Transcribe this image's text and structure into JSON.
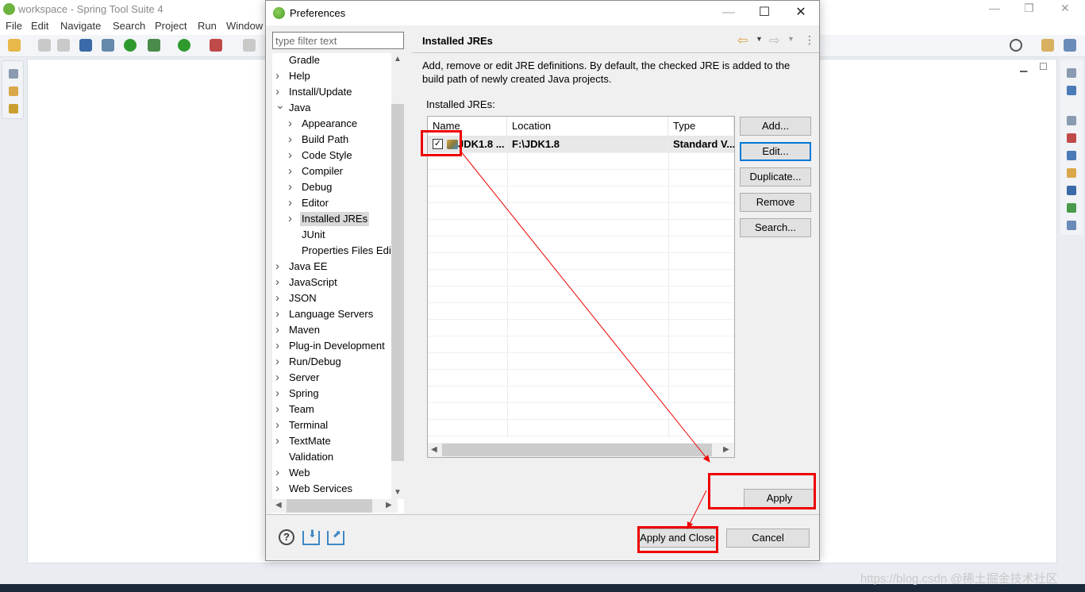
{
  "ide": {
    "title": "workspace - Spring Tool Suite 4",
    "menu": [
      "File",
      "Edit",
      "Navigate",
      "Search",
      "Project",
      "Run",
      "Window"
    ],
    "menu_mnemonics": [
      "F",
      "E",
      "N",
      "S",
      "P",
      "R",
      "W"
    ],
    "watermark": "https://blog.csdn @稀土掘金技术社区"
  },
  "dialog": {
    "title": "Preferences",
    "filter_placeholder": "type filter text",
    "tree": [
      {
        "label": "Gradle",
        "level": 0,
        "chevron": ""
      },
      {
        "label": "Help",
        "level": 0,
        "chevron": ">"
      },
      {
        "label": "Install/Update",
        "level": 0,
        "chevron": ">"
      },
      {
        "label": "Java",
        "level": 0,
        "chevron": "v"
      },
      {
        "label": "Appearance",
        "level": 1,
        "chevron": ">"
      },
      {
        "label": "Build Path",
        "level": 1,
        "chevron": ">"
      },
      {
        "label": "Code Style",
        "level": 1,
        "chevron": ">"
      },
      {
        "label": "Compiler",
        "level": 1,
        "chevron": ">"
      },
      {
        "label": "Debug",
        "level": 1,
        "chevron": ">"
      },
      {
        "label": "Editor",
        "level": 1,
        "chevron": ">"
      },
      {
        "label": "Installed JREs",
        "level": 1,
        "chevron": ">",
        "selected": true
      },
      {
        "label": "JUnit",
        "level": 1,
        "chevron": ""
      },
      {
        "label": "Properties Files Edi",
        "level": 1,
        "chevron": ""
      },
      {
        "label": "Java EE",
        "level": 0,
        "chevron": ">"
      },
      {
        "label": "JavaScript",
        "level": 0,
        "chevron": ">"
      },
      {
        "label": "JSON",
        "level": 0,
        "chevron": ">"
      },
      {
        "label": "Language Servers",
        "level": 0,
        "chevron": ">"
      },
      {
        "label": "Maven",
        "level": 0,
        "chevron": ">"
      },
      {
        "label": "Plug-in Development",
        "level": 0,
        "chevron": ">"
      },
      {
        "label": "Run/Debug",
        "level": 0,
        "chevron": ">"
      },
      {
        "label": "Server",
        "level": 0,
        "chevron": ">"
      },
      {
        "label": "Spring",
        "level": 0,
        "chevron": ">"
      },
      {
        "label": "Team",
        "level": 0,
        "chevron": ">"
      },
      {
        "label": "Terminal",
        "level": 0,
        "chevron": ">"
      },
      {
        "label": "TextMate",
        "level": 0,
        "chevron": ">"
      },
      {
        "label": "Validation",
        "level": 0,
        "chevron": ""
      },
      {
        "label": "Web",
        "level": 0,
        "chevron": ">"
      },
      {
        "label": "Web Services",
        "level": 0,
        "chevron": ">"
      }
    ],
    "page": {
      "title": "Installed JREs",
      "description": "Add, remove or edit JRE definitions. By default, the checked JRE is added to the build path of newly created Java projects.",
      "list_label": "Installed JREs:",
      "columns": [
        "Name",
        "Location",
        "Type"
      ],
      "rows": [
        {
          "name": "JDK1.8 ...",
          "location": "F:\\JDK1.8",
          "type": "Standard V...",
          "checked": true
        }
      ],
      "buttons": {
        "add": "Add...",
        "edit": "Edit...",
        "duplicate": "Duplicate...",
        "remove": "Remove",
        "search": "Search..."
      },
      "apply": "Apply"
    },
    "apply_and_close": "Apply and Close",
    "cancel": "Cancel"
  },
  "colors": {
    "annotation": "#ee0000",
    "focus": "#0078d7",
    "spring_green": "#6db33f"
  }
}
